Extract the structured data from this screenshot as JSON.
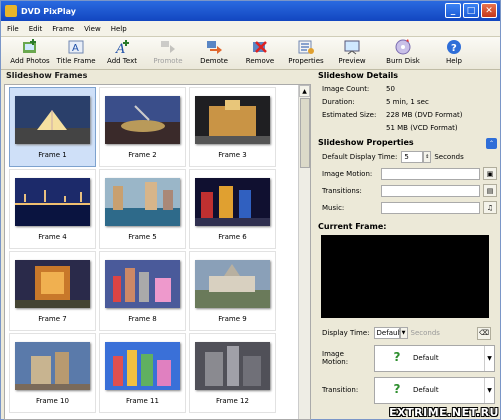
{
  "window": {
    "title": "DVD PixPlay"
  },
  "menu": [
    "File",
    "Edit",
    "Frame",
    "View",
    "Help"
  ],
  "toolbar": [
    {
      "label": "Add Photos",
      "icon": "add-photos-icon",
      "enabled": true
    },
    {
      "label": "Title Frame",
      "icon": "title-frame-icon",
      "enabled": true
    },
    {
      "label": "Add Text",
      "icon": "add-text-icon",
      "enabled": true
    },
    {
      "label": "Promote",
      "icon": "promote-icon",
      "enabled": false
    },
    {
      "label": "Demote",
      "icon": "demote-icon",
      "enabled": true
    },
    {
      "label": "Remove",
      "icon": "remove-icon",
      "enabled": true
    },
    {
      "label": "Properties",
      "icon": "properties-icon",
      "enabled": true
    },
    {
      "label": "Preview",
      "icon": "preview-icon",
      "enabled": true
    },
    {
      "label": "Burn Disk",
      "icon": "burn-disk-icon",
      "enabled": true
    },
    {
      "label": "Help",
      "icon": "help-icon",
      "enabled": true
    }
  ],
  "frames_panel": {
    "title": "Slideshow Frames",
    "frames": [
      {
        "label": "Frame 1"
      },
      {
        "label": "Frame 2"
      },
      {
        "label": "Frame 3"
      },
      {
        "label": "Frame 4"
      },
      {
        "label": "Frame 5"
      },
      {
        "label": "Frame 6"
      },
      {
        "label": "Frame 7"
      },
      {
        "label": "Frame 8"
      },
      {
        "label": "Frame 9"
      },
      {
        "label": "Frame 10"
      },
      {
        "label": "Frame 11"
      },
      {
        "label": "Frame 12"
      }
    ]
  },
  "details": {
    "title": "Slideshow Details",
    "image_count_label": "Image Count:",
    "image_count": "50",
    "duration_label": "Duration:",
    "duration": "5 min, 1 sec",
    "estimated_size_label": "Estimated Size:",
    "estimated_size_dvd": "228 MB (DVD Format)",
    "estimated_size_vcd": "51 MB (VCD Format)"
  },
  "properties": {
    "title": "Slideshow Properties",
    "display_time_label": "Default Display Time:",
    "display_time": "5",
    "display_time_unit": "Seconds",
    "image_motion_label": "Image Motion:",
    "transitions_label": "Transitions:",
    "music_label": "Music:"
  },
  "current_frame": {
    "title": "Current Frame:",
    "display_time_label": "Display Time:",
    "display_time": "Default",
    "display_time_unit": "Seconds",
    "image_motion_label": "Image Motion:",
    "image_motion": "Default",
    "transition_label": "Transition:",
    "transition": "Default"
  },
  "watermark": "EXTRIME.NET.RU"
}
